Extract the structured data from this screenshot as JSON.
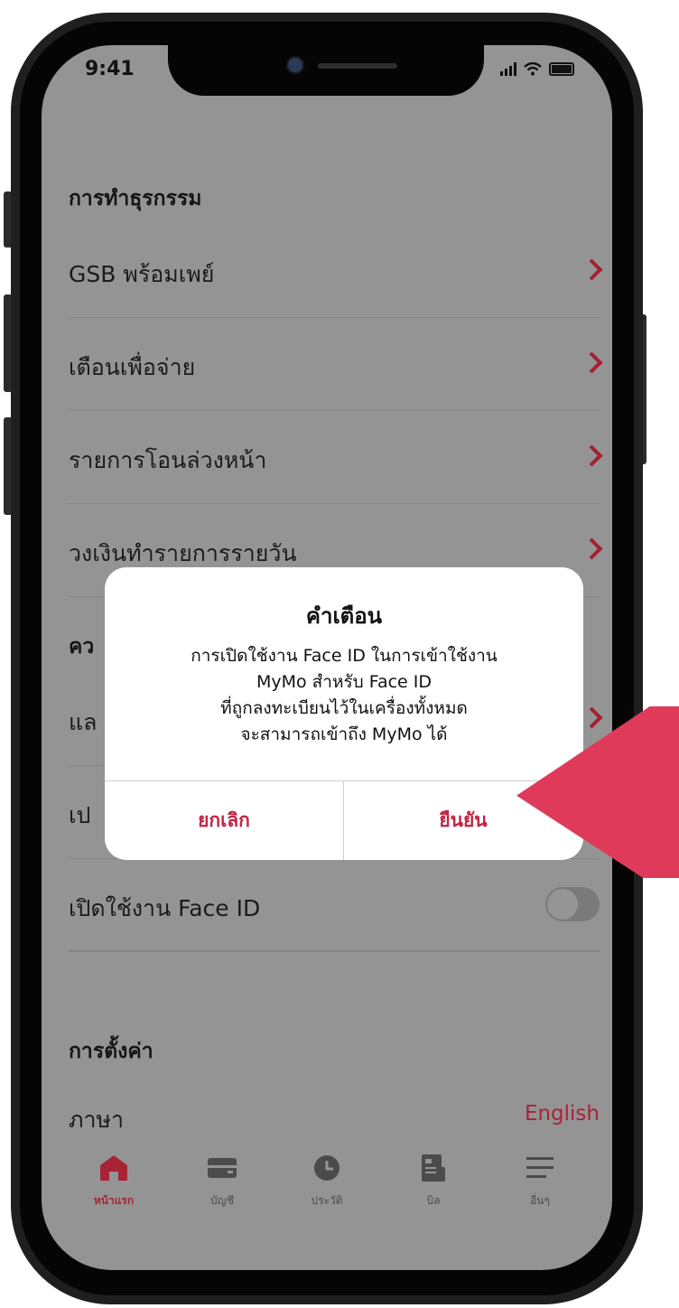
{
  "status_bar": {
    "time": "9:41"
  },
  "sections": {
    "transactions": {
      "title": "การทำธุรกรรม",
      "items": [
        {
          "label": "GSB พร้อมเพย์"
        },
        {
          "label": "เตือนเพื่อจ่าย"
        },
        {
          "label": "รายการโอนล่วงหน้า"
        },
        {
          "label": "วงเงินทำรายการรายวัน"
        }
      ]
    },
    "security": {
      "title_partial": "คว",
      "items": [
        {
          "label": "แล"
        },
        {
          "label": "เป"
        },
        {
          "label": "เปิดใช้งาน Face ID"
        }
      ]
    },
    "settings": {
      "title": "การตั้งค่า",
      "language_label": "ภาษา",
      "language_value": "English"
    }
  },
  "dialog": {
    "title": "คำเตือน",
    "message_lines": [
      "การเปิดใช้งาน Face ID ในการเข้าใช้งาน",
      "MyMo สำหรับ Face ID",
      "ที่ถูกลงทะเบียนไว้ในเครื่องทั้งหมด",
      "จะสามารถเข้าถึง MyMo ได้"
    ],
    "cancel_label": "ยกเลิก",
    "confirm_label": "ยืนยัน"
  },
  "tabbar": {
    "items": [
      {
        "label": "หน้าแรก",
        "icon": "home-icon",
        "active": true
      },
      {
        "label": "บัญชี",
        "icon": "card-icon",
        "active": false
      },
      {
        "label": "ประวัติ",
        "icon": "clock-icon",
        "active": false
      },
      {
        "label": "บิล",
        "icon": "bill-icon",
        "active": false
      },
      {
        "label": "อื่นๆ",
        "icon": "menu-icon",
        "active": false
      }
    ]
  },
  "colors": {
    "accent": "#a82435",
    "pointer": "#e03a5a",
    "overlay_background": "#949494"
  }
}
